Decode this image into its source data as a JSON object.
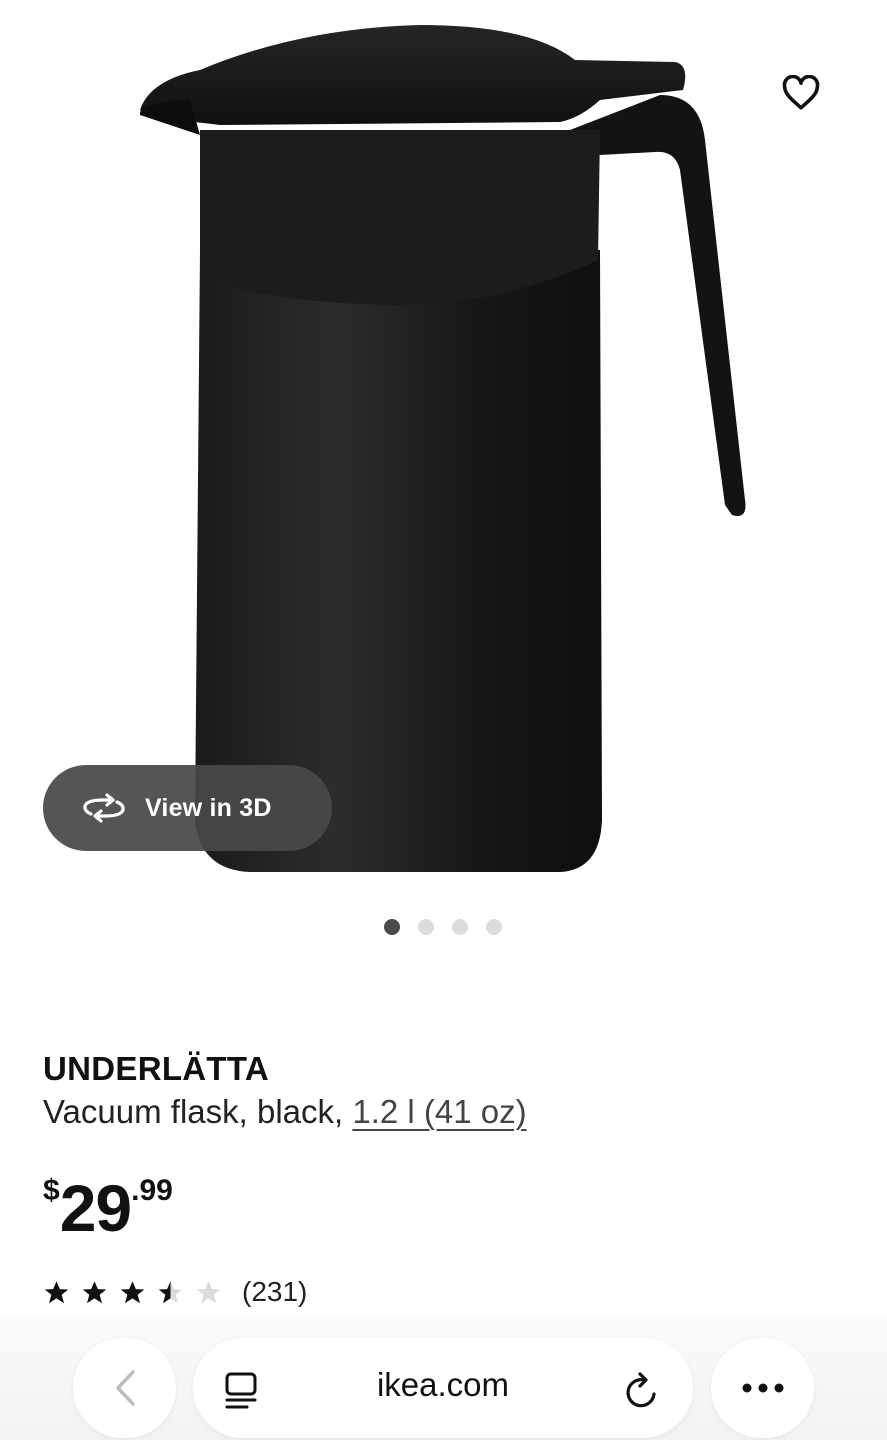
{
  "product": {
    "name": "UNDERLÄTTA",
    "description_prefix": "Vacuum flask, black, ",
    "size_link": "1.2 l (41 oz)"
  },
  "price": {
    "currency": "$",
    "integer": "29",
    "decimal": ".99"
  },
  "rating": {
    "stars": 3.5,
    "max": 5,
    "count": "(231)"
  },
  "gallery": {
    "view3d_label": "View in 3D",
    "image_count": 4,
    "active_index": 0
  },
  "browser": {
    "url": "ikea.com"
  },
  "icons": {
    "favorite": "heart-outline-icon",
    "view3d": "rotate-3d-icon",
    "back": "chevron-left-icon",
    "tabs": "tabs-icon",
    "reload": "reload-icon",
    "more": "more-dots-icon"
  },
  "colors": {
    "product_black": "#151515",
    "button_bg": "#484848",
    "dot_active": "#4a4a4a",
    "dot_inactive": "#dcdcdc"
  }
}
